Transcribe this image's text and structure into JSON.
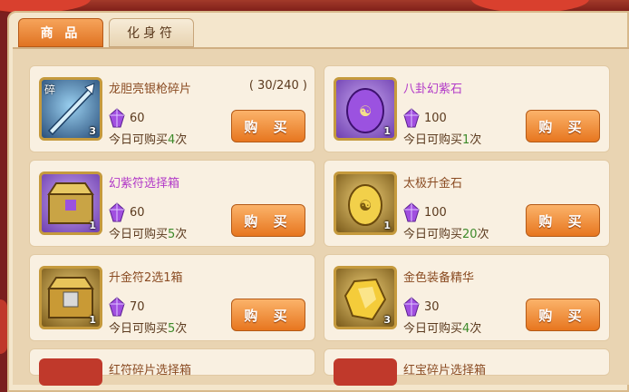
{
  "tabs": [
    {
      "label": "商 品",
      "active": true
    },
    {
      "label": "化身符",
      "active": false
    }
  ],
  "currency_icon": "purple-gem-icon",
  "buy_label": "购 买",
  "limit_prefix": "今日可购买",
  "limit_suffix": "次",
  "items": [
    {
      "name": "龙胆亮银枪碎片",
      "name_color": "#8a4b22",
      "progress": "( 30/240 )",
      "price": "60",
      "limit": "4",
      "qty": "3",
      "corner": "碎",
      "icon": "spear-fragment-icon"
    },
    {
      "name": "八卦幻紫石",
      "name_color": "#b23ac8",
      "progress": "",
      "price": "100",
      "limit": "1",
      "qty": "1",
      "corner": "",
      "icon": "purple-stone-icon"
    },
    {
      "name": "幻紫符选择箱",
      "name_color": "#b23ac8",
      "progress": "",
      "price": "60",
      "limit": "5",
      "qty": "1",
      "corner": "",
      "icon": "purple-chest-icon"
    },
    {
      "name": "太极升金石",
      "name_color": "#8a4b22",
      "progress": "",
      "price": "100",
      "limit": "20",
      "qty": "1",
      "corner": "",
      "icon": "gold-stone-icon"
    },
    {
      "name": "升金符2选1箱",
      "name_color": "#8a4b22",
      "progress": "",
      "price": "70",
      "limit": "5",
      "qty": "1",
      "corner": "",
      "icon": "gold-chest-icon"
    },
    {
      "name": "金色装备精华",
      "name_color": "#8a4b22",
      "progress": "",
      "price": "30",
      "limit": "4",
      "qty": "3",
      "corner": "",
      "icon": "gold-essence-icon"
    }
  ],
  "partial_rows": [
    {
      "name": "红符碎片选择箱"
    },
    {
      "name": "红宝碎片选择箱"
    }
  ]
}
